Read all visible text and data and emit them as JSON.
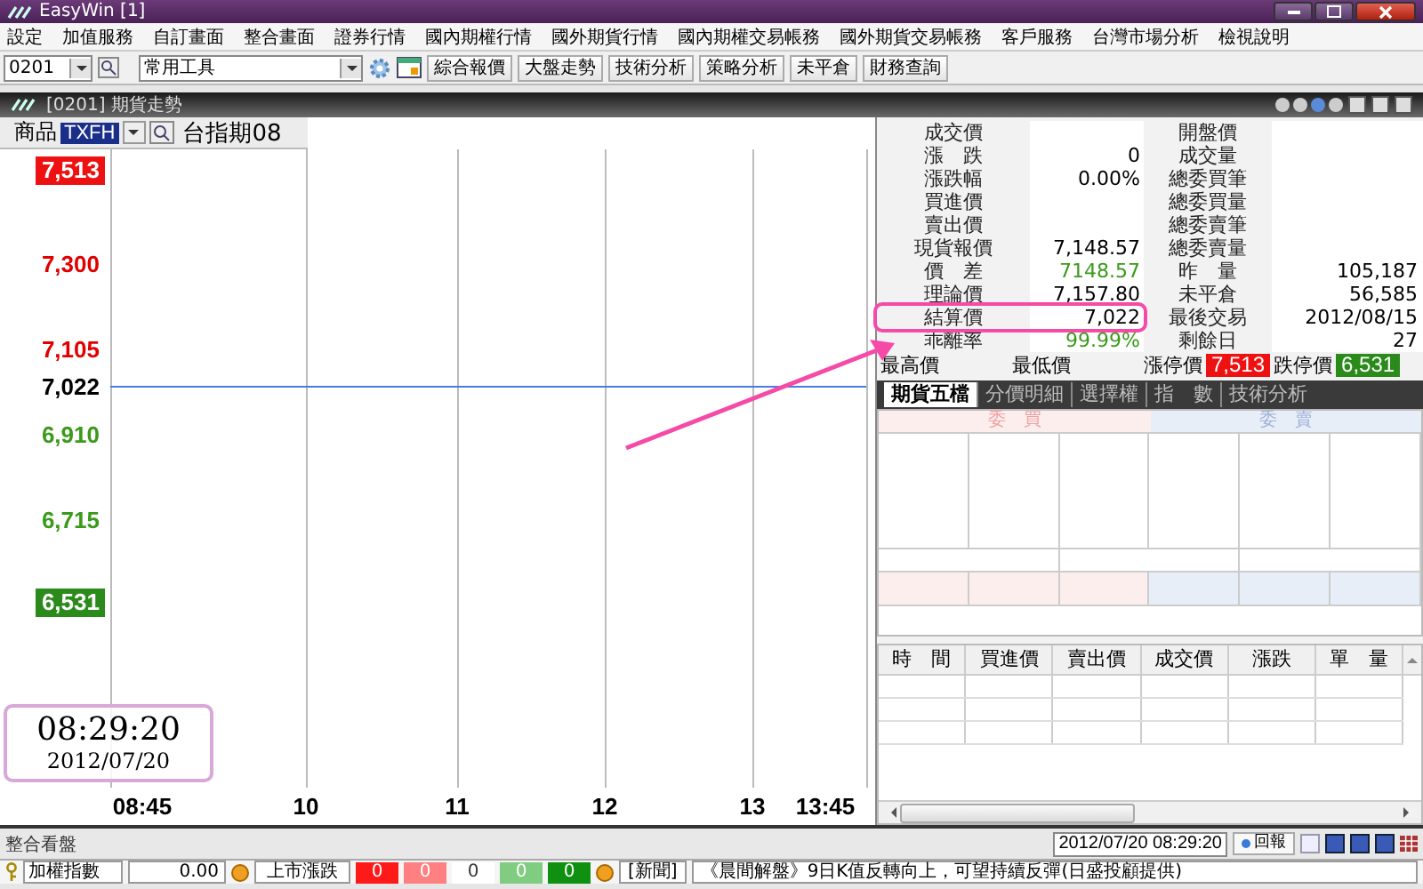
{
  "window": {
    "title": "EasyWin [1]"
  },
  "menu": [
    "設定",
    "加值服務",
    "自訂畫面",
    "整合畫面",
    "證券行情",
    "國內期權行情",
    "國外期貨行情",
    "國內期權交易帳務",
    "國外期貨交易帳務",
    "客戶服務",
    "台灣市場分析",
    "檢視說明"
  ],
  "toolbar": {
    "page_code": "0201",
    "tool_set": "常用工具",
    "buttons": [
      "綜合報價",
      "大盤走勢",
      "技術分析",
      "策略分析",
      "未平倉",
      "財務查詢"
    ]
  },
  "subwindow": {
    "title": "[0201] 期貨走勢"
  },
  "symbol": {
    "label": "商品",
    "code": "TXFH",
    "name": "台指期08"
  },
  "chart": {
    "y_labels": [
      {
        "label": "7,513",
        "kind": "limit_up"
      },
      {
        "label": "7,300",
        "kind": "up"
      },
      {
        "label": "7,105",
        "kind": "up"
      },
      {
        "label": "7,022",
        "kind": "flat"
      },
      {
        "label": "6,910",
        "kind": "down"
      },
      {
        "label": "6,715",
        "kind": "down"
      },
      {
        "label": "6,531",
        "kind": "limit_down"
      }
    ],
    "x_labels": [
      "08:45",
      "10",
      "11",
      "12",
      "13",
      "13:45"
    ]
  },
  "quote_rows": [
    {
      "label": "成交價",
      "label_2": "開盤價"
    },
    {
      "label": "漲　跌",
      "value": "0",
      "label_2": "成交量"
    },
    {
      "label": "漲跌幅",
      "value": "0.00%",
      "label_2": "總委買筆"
    },
    {
      "label": "買進價",
      "label_2": "總委買量"
    },
    {
      "label": "賣出價",
      "label_2": "總委賣筆"
    },
    {
      "label": "現貨報價",
      "value": "7,148.57",
      "label_2": "總委賣量"
    },
    {
      "label": "價　差",
      "value": "7148.57",
      "color": "#3a9a1a",
      "label_2": "昨　量",
      "value_2": "105,187"
    },
    {
      "label": "理論價",
      "value": "7,157.80",
      "label_2": "未平倉",
      "value_2": "56,585"
    },
    {
      "label": "結算價",
      "value": "7,022",
      "highlighted": true,
      "label_2": "最後交易",
      "value_2": "2012/08/15"
    },
    {
      "label": "乖離率",
      "value": "99.99%",
      "color": "#3a9a1a",
      "label_2": "剩餘日",
      "value_2": "27"
    }
  ],
  "summary": [
    {
      "label": "最高價"
    },
    {
      "label": "最低價"
    },
    {
      "label": "漲停價",
      "value": "7,513",
      "kind": "limit_up"
    },
    {
      "label": "跌停價",
      "value": "6,531",
      "kind": "limit_down"
    }
  ],
  "tabs": [
    {
      "label": "期貨五檔",
      "selected": true
    },
    {
      "label": "分價明細",
      "selected": false
    },
    {
      "label": "選擇權",
      "selected": false
    },
    {
      "label": "指　數",
      "selected": false
    },
    {
      "label": "技術分析",
      "selected": false
    }
  ],
  "order_book": {
    "bid_header": "委　買",
    "ask_header": "委　賣"
  },
  "ticks_columns": [
    "時　間",
    "買進價",
    "賣出價",
    "成交價",
    "漲跌",
    "單　量"
  ],
  "clock": {
    "time": "08:29:20",
    "date": "2012/07/20"
  },
  "status": {
    "module": "整合看盤",
    "datetime": "2012/07/20 08:29:20",
    "report_button": "回報"
  },
  "ticker": {
    "index_name": "加權指數",
    "index_value": "0.00",
    "breadth_label": "上市漲跌",
    "breadth": [
      {
        "value": "0",
        "color": "#ff1a1a"
      },
      {
        "value": "0",
        "color": "#ff8080"
      },
      {
        "value": "0",
        "color": "#ffffff"
      },
      {
        "value": "0",
        "color": "#80cc80"
      },
      {
        "value": "0",
        "color": "#109010"
      }
    ],
    "news_tag": "[新聞]",
    "headline": "《晨間解盤》9日K值反轉向上，可望持續反彈(日盛投顧提供)"
  }
}
